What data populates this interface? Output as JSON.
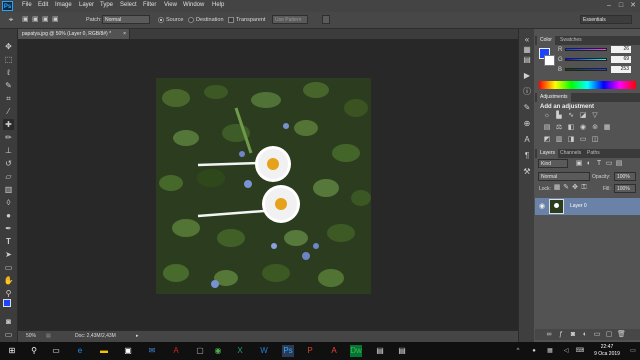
{
  "app": {
    "logo": "Ps",
    "menu": [
      "File",
      "Edit",
      "Image",
      "Layer",
      "Type",
      "Select",
      "Filter",
      "View",
      "Window",
      "Help"
    ]
  },
  "options_bar": {
    "patch_label": "Patch:",
    "patch_mode": "Normal",
    "source_label": "Source",
    "destination_label": "Destination",
    "transparent_label": "Transparent",
    "use_pattern_label": "Use Pattern",
    "workspace": "Essentials"
  },
  "document": {
    "tab_title": "papatya.jpg @ 50% (Layer 0, RGB/8#) *",
    "zoom": "50%",
    "doc_size": "Doc: 2,43M/2,43M"
  },
  "color_panel": {
    "tabs": [
      "Color",
      "Swatches"
    ],
    "r_value": "26",
    "g_value": "69",
    "b_value": "253",
    "r_label": "R",
    "g_label": "G",
    "b_label": "B",
    "foreground_color": "#1a45fd"
  },
  "adjustments_panel": {
    "title": "Adjustments",
    "subtitle": "Add an adjustment"
  },
  "layers_panel": {
    "tabs": [
      "Layers",
      "Channels",
      "Paths"
    ],
    "kind_label": "Kind",
    "blend_mode": "Normal",
    "opacity_label": "Opacity:",
    "opacity_value": "100%",
    "lock_label": "Lock:",
    "fill_label": "Fill:",
    "fill_value": "100%",
    "layer_name": "Layer 0"
  },
  "taskbar": {
    "time": "22:47",
    "date": "9 Oca 2019"
  },
  "colors": {
    "accent": "#2f72d6",
    "layer_selected": "#6a82a8",
    "canvas_bg": "#282828"
  }
}
